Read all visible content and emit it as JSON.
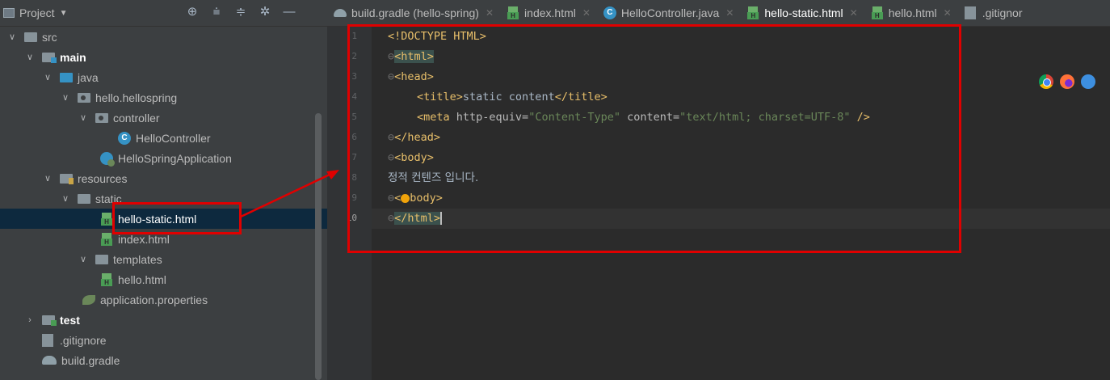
{
  "project_panel": {
    "title": "Project",
    "tree": [
      {
        "label": "src",
        "level": 0,
        "expanded": true,
        "icon": "folder-icon"
      },
      {
        "label": "main",
        "level": 1,
        "expanded": true,
        "icon": "source-root-folder-icon",
        "bold": true
      },
      {
        "label": "java",
        "level": 2,
        "expanded": true,
        "icon": "java-folder-icon"
      },
      {
        "label": "hello.hellospring",
        "level": 3,
        "expanded": true,
        "icon": "package-icon"
      },
      {
        "label": "controller",
        "level": 4,
        "expanded": true,
        "icon": "package-icon"
      },
      {
        "label": "HelloController",
        "level": 5,
        "icon": "class-icon"
      },
      {
        "label": "HelloSpringApplication",
        "level": 4,
        "icon": "spring-app-icon"
      },
      {
        "label": "resources",
        "level": 2,
        "expanded": true,
        "icon": "resources-folder-icon"
      },
      {
        "label": "static",
        "level": 3,
        "expanded": true,
        "icon": "folder-icon"
      },
      {
        "label": "hello-static.html",
        "level": 4,
        "icon": "html-file-icon",
        "selected": true
      },
      {
        "label": "index.html",
        "level": 4,
        "icon": "html-file-icon"
      },
      {
        "label": "templates",
        "level": 3,
        "expanded": true,
        "icon": "folder-icon"
      },
      {
        "label": "hello.html",
        "level": 4,
        "icon": "html-file-icon"
      },
      {
        "label": "application.properties",
        "level": 3,
        "icon": "properties-file-icon"
      },
      {
        "label": "test",
        "level": 1,
        "expanded": false,
        "icon": "test-folder-icon",
        "bold": true
      },
      {
        "label": ".gitignore",
        "level": 0,
        "icon": "gitignore-file-icon"
      },
      {
        "label": "build.gradle",
        "level": 0,
        "icon": "gradle-icon"
      }
    ]
  },
  "tabs": [
    {
      "label": "build.gradle (hello-spring)",
      "icon": "gradle-icon"
    },
    {
      "label": "index.html",
      "icon": "html-file-icon"
    },
    {
      "label": "HelloController.java",
      "icon": "class-icon"
    },
    {
      "label": "hello-static.html",
      "icon": "html-file-icon",
      "active": true
    },
    {
      "label": "hello.html",
      "icon": "html-file-icon"
    },
    {
      "label": ".gitignor",
      "icon": "gitignore-file-icon"
    }
  ],
  "editor": {
    "line_numbers": [
      "1",
      "2",
      "3",
      "4",
      "5",
      "6",
      "7",
      "8",
      "9",
      "10"
    ],
    "current_line": "10",
    "code": {
      "l1": "<!DOCTYPE HTML>",
      "l2": "<html>",
      "l3": "<head>",
      "l4_open": "<title>",
      "l4_text": "static content",
      "l4_close": "</title>",
      "l5_open": "<meta ",
      "l5_attr1": "http-equiv=",
      "l5_val1": "\"Content-Type\"",
      "l5_attr2": " content=",
      "l5_val2": "\"text/html; charset=UTF-8\"",
      "l5_close": " />",
      "l6": "</head>",
      "l7": "<body>",
      "l8": "정적 컨텐즈 입니다.",
      "l9_a": "<",
      "l9_b": "body>",
      "l10": "</html>"
    }
  }
}
